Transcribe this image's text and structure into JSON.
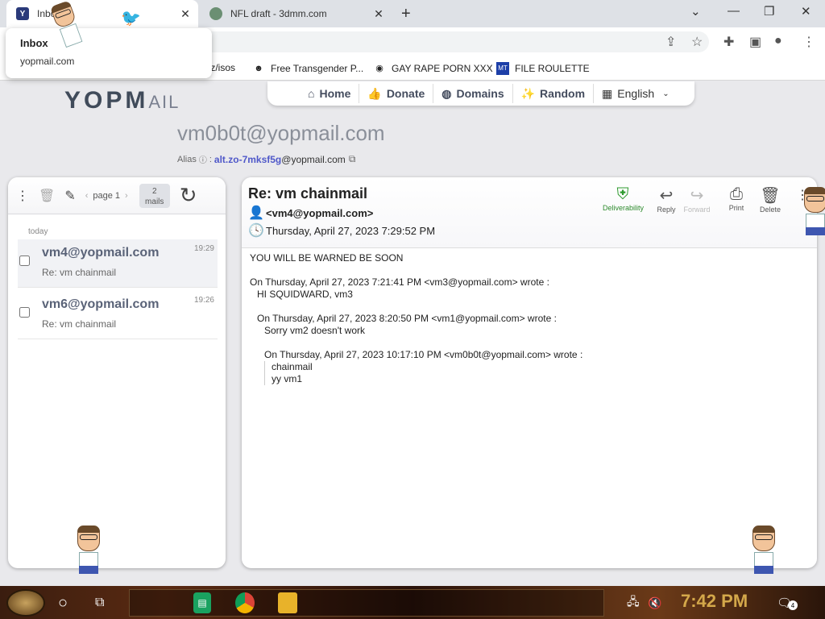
{
  "browser": {
    "tabs": [
      {
        "title": "Inbox",
        "favicon": "Y",
        "active": true
      },
      {
        "title": "NFL draft - 3dmm.com",
        "favicon": "globe",
        "active": false
      }
    ],
    "new_tab": "+",
    "window_controls": {
      "tab_list": "⌄",
      "minimize": "—",
      "restore": "❐",
      "close": "✕"
    },
    "tooltip": {
      "title": "Inbox",
      "subtitle": "yopmail.com"
    },
    "bookmarks": [
      {
        "label": "tz/isos",
        "icon": "none"
      },
      {
        "label": "Free Transgender P...",
        "icon": "mask-icon"
      },
      {
        "label": "GAY RAPE PORN XXX",
        "icon": "globe-icon"
      },
      {
        "label": "FILE ROULETTE",
        "icon": "file-icon"
      }
    ]
  },
  "yopmail": {
    "logo_main": "YOPM",
    "logo_tail": "AIL",
    "nav": [
      {
        "label": "Home",
        "icon": "⌂"
      },
      {
        "label": "Donate",
        "icon": "👍"
      },
      {
        "label": "Domains",
        "icon": "🌐"
      },
      {
        "label": "Random",
        "icon": "✨"
      }
    ],
    "language": "English",
    "address": "vm0b0t@yopmail.com",
    "alias_label": "Alias",
    "alias_separator": ":",
    "alias_prefix": "alt.zo-7mksf5g",
    "alias_domain": "@yopmail.com"
  },
  "inbox": {
    "page_label": "page 1",
    "mail_count": "2",
    "mail_unit": "mails",
    "group_label": "today",
    "messages": [
      {
        "from": "vm4@yopmail.com",
        "subject": "Re: vm chainmail",
        "time": "19:29",
        "selected": true
      },
      {
        "from": "vm6@yopmail.com",
        "subject": "Re: vm chainmail",
        "time": "19:26",
        "selected": false
      }
    ]
  },
  "message": {
    "subject": "Re: vm chainmail",
    "from": "<vm4@yopmail.com>",
    "date": "Thursday, April 27, 2023 7:29:52 PM",
    "actions": [
      {
        "label": "Deliverability",
        "icon": "shield-check"
      },
      {
        "label": "Reply",
        "icon": "reply"
      },
      {
        "label": "Forward",
        "icon": "forward"
      },
      {
        "label": "Print",
        "icon": "printer"
      },
      {
        "label": "Delete",
        "icon": "trash"
      }
    ],
    "body": {
      "line1": "YOU WILL BE WARNED BE SOON",
      "q1_header": "On Thursday, April 27, 2023 7:21:41 PM <vm3@yopmail.com> wrote :",
      "q1_text": "HI SQUIDWARD, vm3",
      "q2_header": "On Thursday, April 27, 2023 8:20:50 PM <vm1@yopmail.com> wrote :",
      "q2_text": "Sorry vm2 doesn't work",
      "q3_header": "On Thursday, April 27, 2023 10:17:10 PM <vm0b0t@yopmail.com> wrote :",
      "q3_text1": "chainmail",
      "q3_text2": "yy vm1"
    }
  },
  "taskbar": {
    "clock": "7:42 PM",
    "notification_count": "4"
  }
}
